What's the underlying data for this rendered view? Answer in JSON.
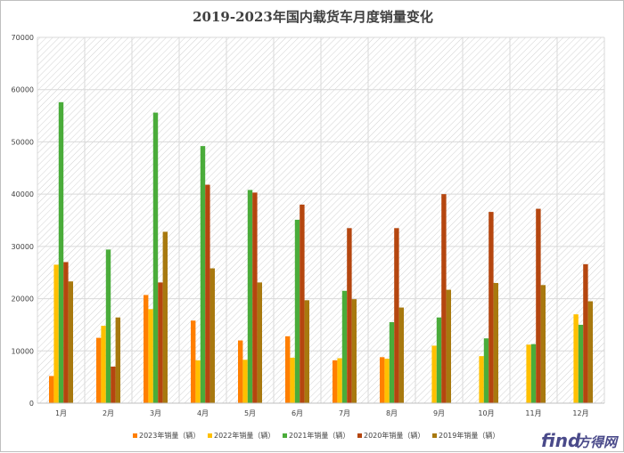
{
  "chart_data": {
    "type": "bar",
    "title": "2019-2023年国内载货车月度销量变化",
    "categories": [
      "1月",
      "2月",
      "3月",
      "4月",
      "5月",
      "6月",
      "7月",
      "8月",
      "9月",
      "10月",
      "11月",
      "12月"
    ],
    "ylim": [
      0,
      70000
    ],
    "yticks": [
      "0",
      "10000",
      "20000",
      "30000",
      "40000",
      "50000",
      "60000",
      "70000"
    ],
    "grid": true,
    "legend_position": "bottom",
    "series": [
      {
        "name": "2023年销量（辆）",
        "color": "#ff7f00",
        "values": [
          5200,
          12500,
          20700,
          15800,
          12000,
          12800,
          8200,
          8800,
          null,
          null,
          null,
          null
        ]
      },
      {
        "name": "2022年销量（辆）",
        "color": "#ffc000",
        "values": [
          26500,
          14800,
          18000,
          8200,
          8300,
          8700,
          8600,
          8500,
          11000,
          9000,
          11200,
          17000
        ]
      },
      {
        "name": "2021年销量（辆）",
        "color": "#4aac3a",
        "values": [
          57600,
          29400,
          55600,
          49200,
          40800,
          35100,
          21500,
          15500,
          16400,
          12400,
          11300,
          15000
        ]
      },
      {
        "name": "2020年销量（辆）",
        "color": "#b5460f",
        "values": [
          27000,
          7000,
          23100,
          41800,
          40300,
          38000,
          33500,
          33500,
          40000,
          36600,
          37200,
          26600
        ]
      },
      {
        "name": "2019年销量（辆）",
        "color": "#a8790f",
        "values": [
          23300,
          16400,
          32800,
          25800,
          23100,
          19700,
          19900,
          18300,
          21700,
          23000,
          22600,
          19500
        ]
      }
    ]
  },
  "watermark": {
    "text_left": "find",
    "text_right": "方得网",
    "color": "#4a4a8a"
  }
}
